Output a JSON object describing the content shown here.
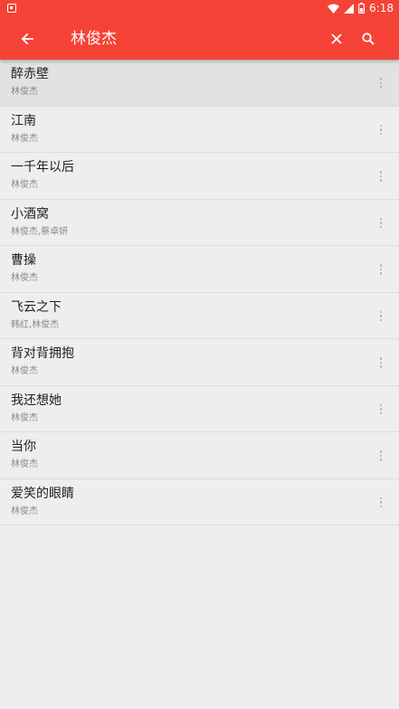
{
  "status_bar": {
    "time": "6:18"
  },
  "app_bar": {
    "query": "林俊杰",
    "color": "#f44336"
  },
  "songs": [
    {
      "title": "醉赤壁",
      "artist": "林俊杰"
    },
    {
      "title": "江南",
      "artist": "林俊杰"
    },
    {
      "title": "一千年以后",
      "artist": "林俊杰"
    },
    {
      "title": "小酒窝",
      "artist": "林俊杰,蔡卓妍"
    },
    {
      "title": "曹操",
      "artist": "林俊杰"
    },
    {
      "title": "飞云之下",
      "artist": "韩红,林俊杰"
    },
    {
      "title": "背对背拥抱",
      "artist": "林俊杰"
    },
    {
      "title": "我还想她",
      "artist": "林俊杰"
    },
    {
      "title": "当你",
      "artist": "林俊杰"
    },
    {
      "title": "爱笑的眼睛",
      "artist": "林俊杰"
    }
  ]
}
